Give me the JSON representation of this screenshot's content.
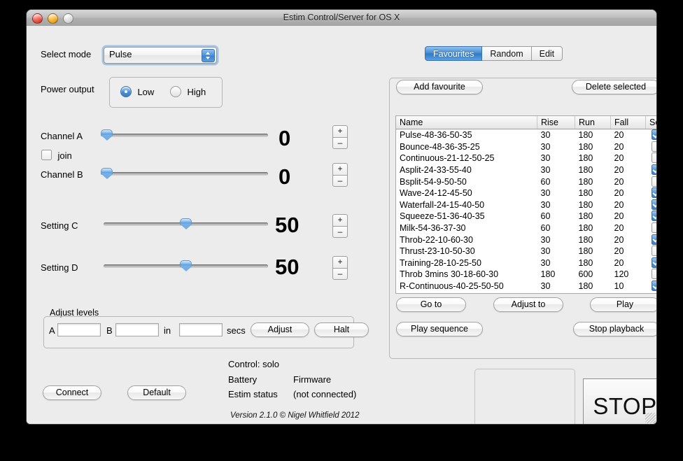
{
  "window": {
    "title": "Estim Control/Server for OS X",
    "traffic_lights": [
      "close-button",
      "minimize-button",
      "zoom-button"
    ]
  },
  "left": {
    "select_mode_label": "Select mode",
    "mode_value": "Pulse",
    "power_output_label": "Power output",
    "power_options": [
      {
        "label": "Low",
        "selected": true
      },
      {
        "label": "High",
        "selected": false
      }
    ],
    "channels": [
      {
        "label": "Channel A",
        "value": "0",
        "percent": 2
      },
      {
        "label": "Channel B",
        "value": "0",
        "percent": 2
      }
    ],
    "join_label": "join",
    "join_checked": false,
    "settings": [
      {
        "label": "Setting C",
        "value": "50",
        "percent": 50
      },
      {
        "label": "Setting D",
        "value": "50",
        "percent": 50
      }
    ],
    "stepper_plus": "+",
    "stepper_minus": "–",
    "adjust_levels": {
      "title": "Adjust levels",
      "a_label": "A",
      "a_value": "",
      "b_label": "B",
      "b_value": "",
      "in_label": "in",
      "secs_value": "",
      "secs_label": "secs",
      "adjust_button": "Adjust",
      "halt_button": "Halt"
    },
    "connect_button": "Connect",
    "default_button": "Default"
  },
  "status": {
    "control": "Control: solo",
    "battery_label": "Battery",
    "battery_value": "",
    "firmware_label": "Firmware",
    "firmware_value": "",
    "estim_status_label": "Estim status",
    "estim_status_value": "(not connected)",
    "version": "Version 2.1.0 © Nigel Whitfield 2012"
  },
  "right": {
    "tabs": [
      {
        "label": "Favourites",
        "selected": true
      },
      {
        "label": "Random",
        "selected": false
      },
      {
        "label": "Edit",
        "selected": false
      }
    ],
    "add_favourite_button": "Add favourite",
    "delete_selected_button": "Delete selected",
    "table": {
      "columns": [
        "Name",
        "Rise",
        "Run",
        "Fall",
        "Seq"
      ],
      "rows": [
        {
          "name": "Pulse-48-36-50-35",
          "rise": "30",
          "run": "180",
          "fall": "20",
          "seq": true
        },
        {
          "name": "Bounce-48-36-35-25",
          "rise": "30",
          "run": "180",
          "fall": "20",
          "seq": false
        },
        {
          "name": "Continuous-21-12-50-25",
          "rise": "30",
          "run": "180",
          "fall": "20",
          "seq": false
        },
        {
          "name": "Asplit-24-33-55-40",
          "rise": "30",
          "run": "180",
          "fall": "20",
          "seq": true
        },
        {
          "name": "Bsplit-54-9-50-50",
          "rise": "60",
          "run": "180",
          "fall": "20",
          "seq": false
        },
        {
          "name": "Wave-24-12-45-50",
          "rise": "30",
          "run": "180",
          "fall": "20",
          "seq": true
        },
        {
          "name": "Waterfall-24-15-40-50",
          "rise": "30",
          "run": "180",
          "fall": "20",
          "seq": true
        },
        {
          "name": "Squeeze-51-36-40-35",
          "rise": "60",
          "run": "180",
          "fall": "20",
          "seq": true
        },
        {
          "name": "Milk-54-36-37-30",
          "rise": "60",
          "run": "180",
          "fall": "20",
          "seq": false
        },
        {
          "name": "Throb-22-10-60-30",
          "rise": "30",
          "run": "180",
          "fall": "20",
          "seq": true
        },
        {
          "name": "Thrust-23-10-50-30",
          "rise": "30",
          "run": "180",
          "fall": "20",
          "seq": false
        },
        {
          "name": "Training-28-10-25-50",
          "rise": "30",
          "run": "180",
          "fall": "20",
          "seq": true
        },
        {
          "name": "Throb 3mins 30-18-60-30",
          "rise": "180",
          "run": "600",
          "fall": "120",
          "seq": false
        },
        {
          "name": "R-Continuous-40-25-50-50",
          "rise": "30",
          "run": "180",
          "fall": "10",
          "seq": true
        }
      ]
    },
    "goto_button": "Go to",
    "adjust_to_button": "Adjust to",
    "play_button": "Play",
    "play_sequence_button": "Play sequence",
    "stop_playback_button": "Stop playback"
  },
  "stop_button": "STOP",
  "colors": {
    "accent_blue": "#3f86cf",
    "window_bg": "#ececec",
    "desktop": "#000000"
  }
}
